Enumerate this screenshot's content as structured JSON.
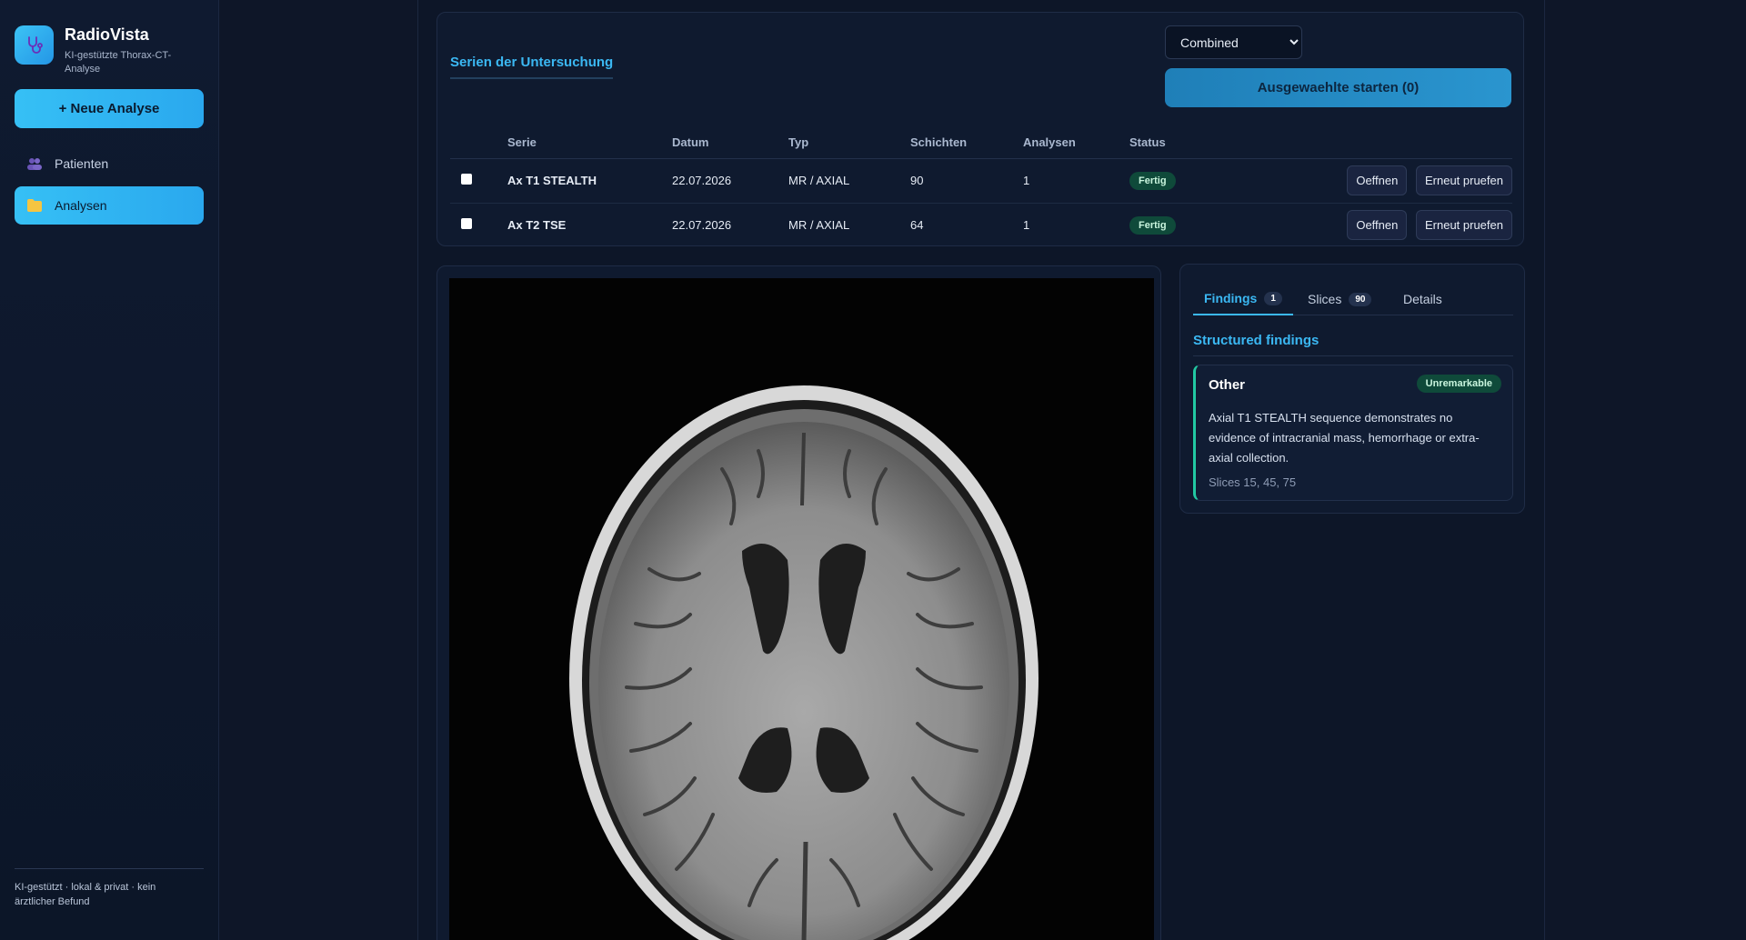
{
  "app": {
    "title": "RadioVista",
    "subtitle": "KI-gestützte Thorax-CT-Analyse",
    "new_analysis": "+ Neue Analyse",
    "footer": "KI-gestützt · lokal & privat · kein ärztlicher Befund"
  },
  "sidebar": {
    "items": [
      {
        "label": "Patienten",
        "icon": "users-icon",
        "active": false
      },
      {
        "label": "Analysen",
        "icon": "folder-icon",
        "active": true
      }
    ]
  },
  "series_panel": {
    "tab_label": "Serien der Untersuchung",
    "mode_options": [
      "Combined"
    ],
    "mode_selected": "Combined",
    "start_button": "Ausgewaehlte starten (0)",
    "columns": [
      "",
      "Serie",
      "Datum",
      "Typ",
      "Schichten",
      "Analysen",
      "Status",
      ""
    ],
    "rows": [
      {
        "serie": "Ax T1 STEALTH",
        "datum": "22.07.2026",
        "typ": "MR / AXIAL",
        "schichten": "90",
        "analysen": "1",
        "status": "Fertig",
        "open": "Oeffnen",
        "recheck": "Erneut pruefen"
      },
      {
        "serie": "Ax T2 TSE",
        "datum": "22.07.2026",
        "typ": "MR / AXIAL",
        "schichten": "64",
        "analysen": "1",
        "status": "Fertig",
        "open": "Oeffnen",
        "recheck": "Erneut pruefen"
      }
    ]
  },
  "findings_panel": {
    "tabs": [
      {
        "label": "Findings",
        "count": "1",
        "active": true
      },
      {
        "label": "Slices",
        "count": "90",
        "active": false
      },
      {
        "label": "Details",
        "count": "",
        "active": false
      }
    ],
    "section_title": "Structured findings",
    "finding": {
      "title": "Other",
      "badge": "Unremarkable",
      "text": "Axial T1 STEALTH sequence demonstrates no evidence of intracranial mass, hemorrhage or extra-axial collection.",
      "slices": "Slices 15, 45, 75"
    }
  },
  "colors": {
    "accent": "#36c0f5",
    "background": "#0e1628",
    "status_ok": "#0f4a3a",
    "finding_border": "#22c9a3"
  }
}
